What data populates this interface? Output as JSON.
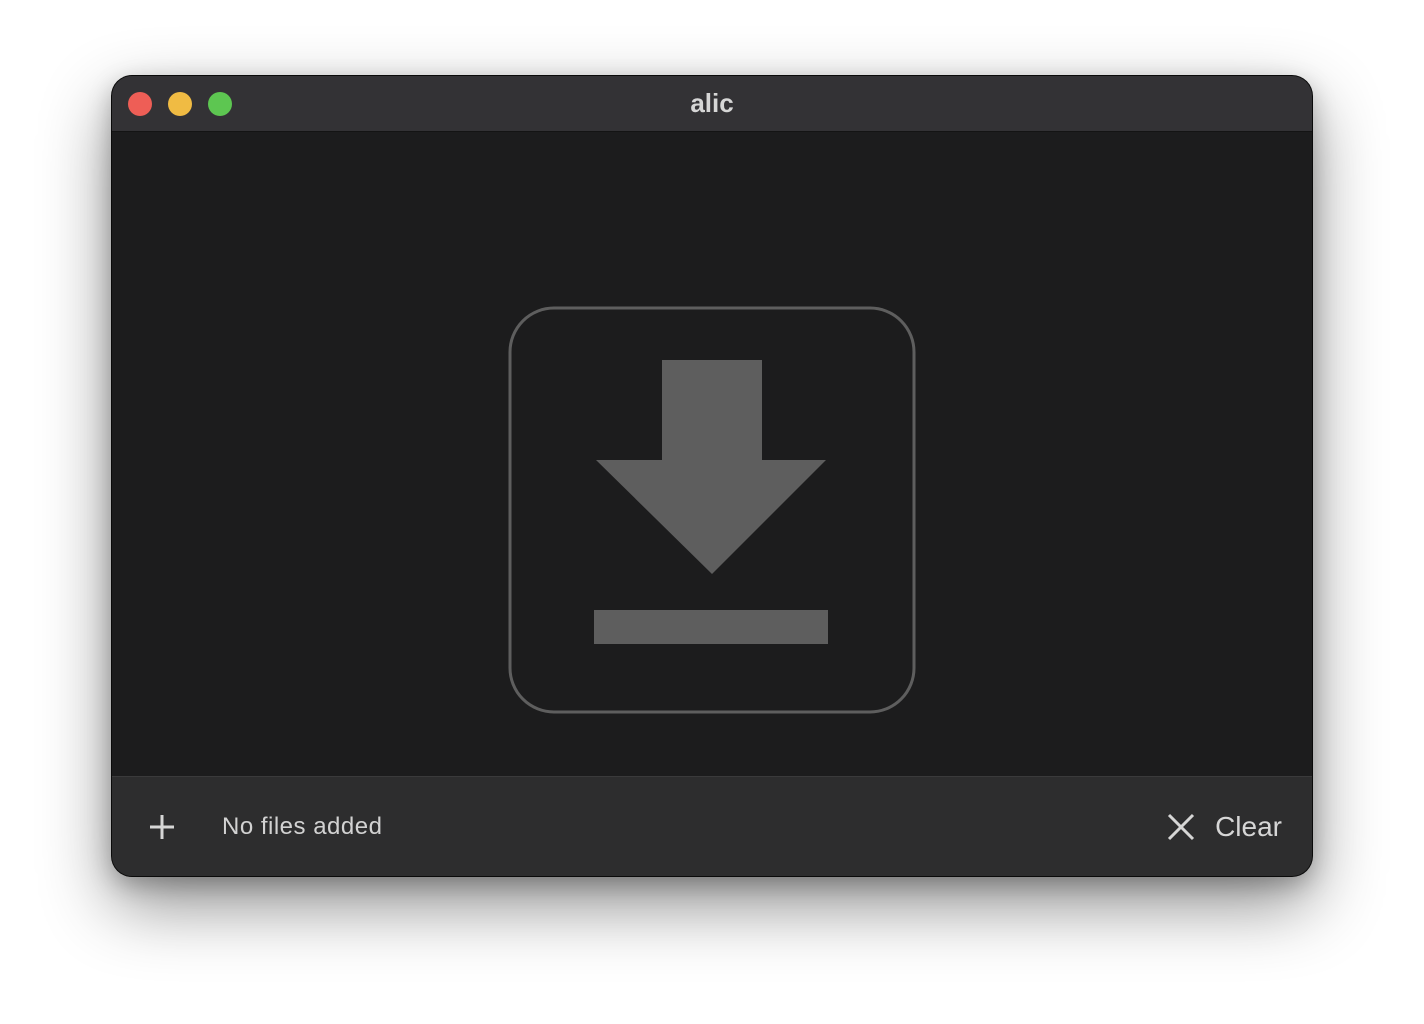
{
  "window": {
    "title": "alic",
    "traffic_lights": {
      "close": "#ee5e56",
      "minimize": "#f0bb43",
      "maximize": "#5dc651"
    }
  },
  "drop_area": {
    "icon": "download-icon",
    "icon_color": "#5e5e5e"
  },
  "footer": {
    "add_icon": "plus-icon",
    "status_text": "No files added",
    "clear_icon": "close-x-icon",
    "clear_label": "Clear"
  }
}
